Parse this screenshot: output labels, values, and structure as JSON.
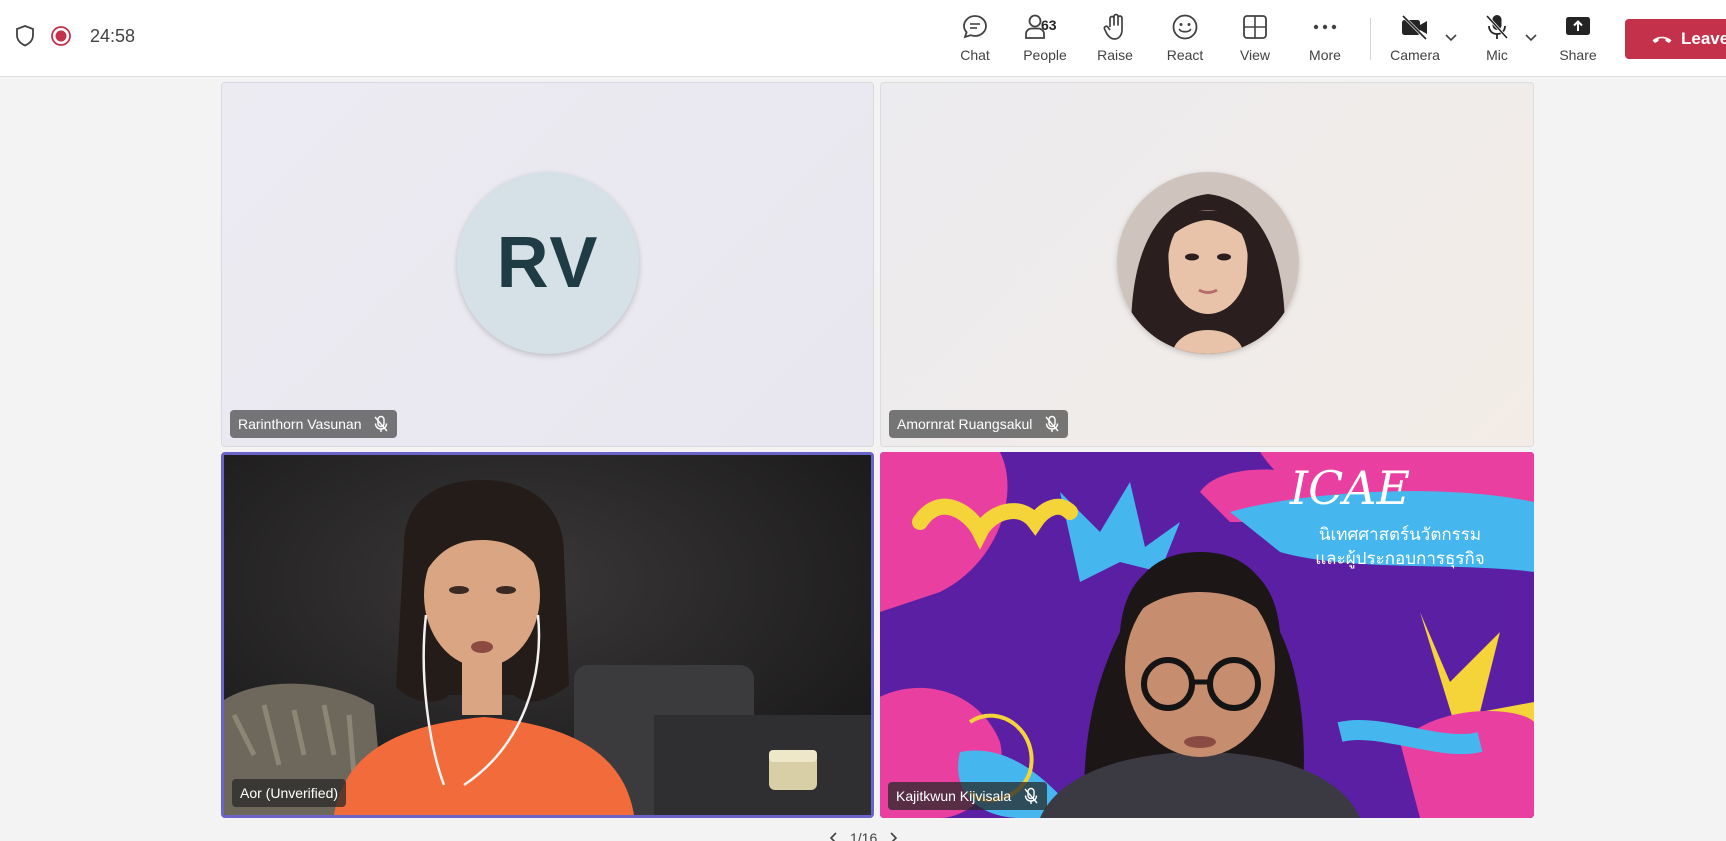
{
  "meeting": {
    "timer": "24:58"
  },
  "toolbar": {
    "chat": "Chat",
    "people": "People",
    "people_count": "63",
    "raise": "Raise",
    "react": "React",
    "view": "View",
    "more": "More",
    "camera": "Camera",
    "mic": "Mic",
    "share": "Share",
    "leave": "Leave"
  },
  "participants": [
    {
      "name": "Rarinthorn Vasunan",
      "initials": "RV",
      "muted": true
    },
    {
      "name": "Amornrat Ruangsakul",
      "muted": true
    },
    {
      "name": "Aor (Unverified)",
      "muted": false
    },
    {
      "name": "Kajitkwun Kijvisala",
      "muted": true
    }
  ],
  "background": {
    "brand": "ICAE",
    "line1": "นิเทศศาสตร์นวัตกรรม",
    "line2": "และผู้ประกอบการธุรกิจ"
  },
  "pager": {
    "label": "1/16"
  },
  "colors": {
    "leave": "#c4314b",
    "active_speaker_border": "#6b63c9",
    "record": "#c4314b"
  }
}
